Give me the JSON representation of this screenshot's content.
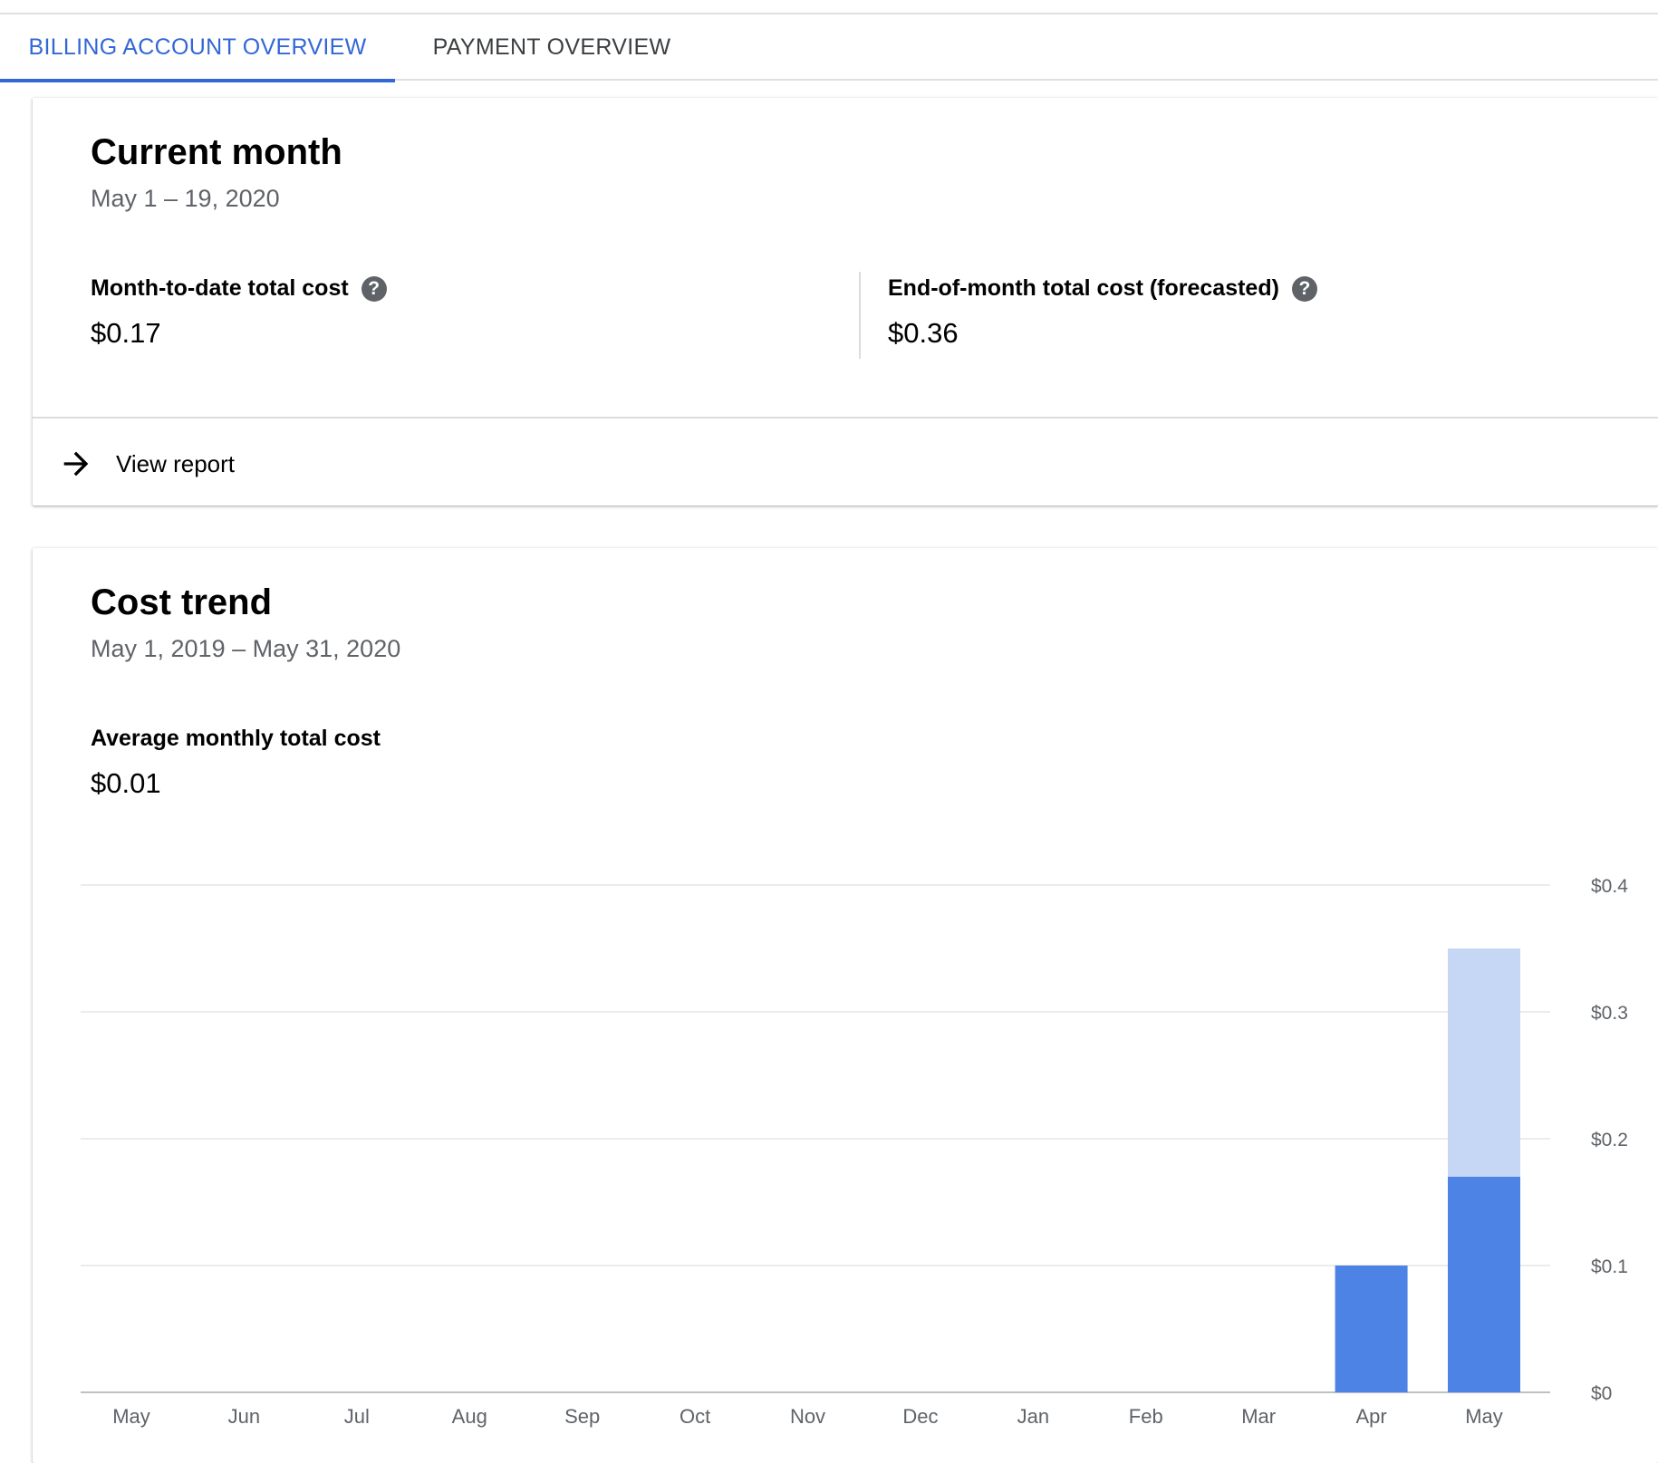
{
  "tabs": [
    {
      "label": "BILLING ACCOUNT OVERVIEW",
      "active": true
    },
    {
      "label": "PAYMENT OVERVIEW",
      "active": false
    }
  ],
  "current_month": {
    "title": "Current month",
    "date_range": "May 1 – 19, 2020",
    "mtd_label": "Month-to-date total cost",
    "mtd_value": "$0.17",
    "eom_label": "End-of-month total cost (forecasted)",
    "eom_value": "$0.36",
    "help_icon": "?",
    "view_report_label": "View report"
  },
  "cost_trend": {
    "title": "Cost trend",
    "date_range": "May 1, 2019 – May 31, 2020",
    "avg_label": "Average monthly total cost",
    "avg_value": "$0.01"
  },
  "colors": {
    "accent": "#3367d6",
    "bar_actual": "#4e83e6",
    "bar_forecast": "#c6d7f6"
  },
  "chart_data": {
    "type": "bar",
    "stacked": true,
    "categories": [
      "May",
      "Jun",
      "Jul",
      "Aug",
      "Sep",
      "Oct",
      "Nov",
      "Dec",
      "Jan",
      "Feb",
      "Mar",
      "Apr",
      "May"
    ],
    "series": [
      {
        "values": [
          0,
          0,
          0,
          0,
          0,
          0,
          0,
          0,
          0,
          0,
          0,
          0.1,
          0.17
        ]
      },
      {
        "values": [
          0,
          0,
          0,
          0,
          0,
          0,
          0,
          0,
          0,
          0,
          0,
          0,
          0.18
        ]
      }
    ],
    "y_ticks": [
      "$0",
      "$0.1",
      "$0.2",
      "$0.3",
      "$0.4"
    ],
    "ylim": [
      0,
      0.4
    ],
    "grid": true,
    "y_axis_position": "right"
  }
}
